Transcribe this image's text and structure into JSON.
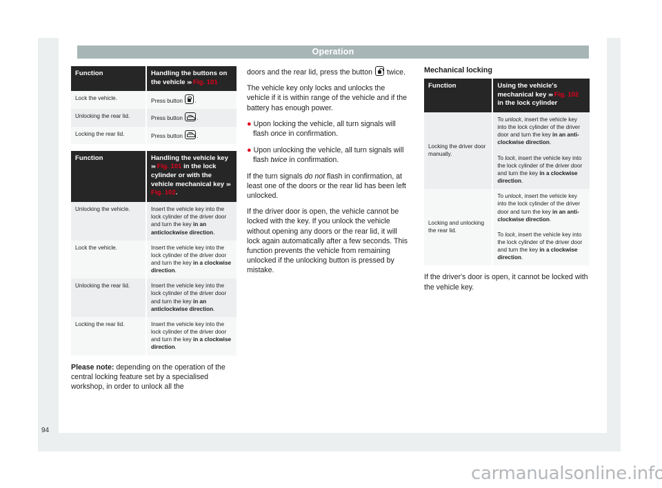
{
  "page": {
    "header_title": "Operation",
    "page_number": "94",
    "watermark": "carmanualsonline.info"
  },
  "column1": {
    "table_buttons": {
      "head_function": "Function",
      "head_handling": "Handling the buttons on the vehicle ››› Fig. 101",
      "head_handling_pre": "Handling the buttons on the vehicle",
      "head_handling_fig": "Fig. 101",
      "rows": [
        {
          "function": "Lock the vehicle.",
          "action_pre": "Press button ",
          "action_icon": "lock-icon",
          "action_post": "."
        },
        {
          "function": "Unlocking the rear lid.",
          "action_pre": "Press button ",
          "action_icon": "trunk-icon",
          "action_post": "."
        },
        {
          "function": "Locking the rear lid.",
          "action_pre": "Press button ",
          "action_icon": "trunk-icon",
          "action_post": "."
        }
      ]
    },
    "table_key": {
      "head_function": "Function",
      "head_handling_a": "Handling the vehicle key",
      "head_fig_101": "Fig. 101",
      "head_handling_b": "in the lock cylinder or with the vehicle mechanical key",
      "head_fig_102": "Fig. 102",
      "head_handling_end": ".",
      "rows": [
        {
          "function": "Unlocking the vehicle.",
          "text_pre": "Insert the vehicle key into the lock cylinder of the driver door and turn the key ",
          "text_bold": "in an anticlockwise direction",
          "text_post": "."
        },
        {
          "function": "Lock the vehicle.",
          "text_pre": "Insert the vehicle key into the lock cylinder of the driver door and turn the key ",
          "text_bold": "in a clockwise direction",
          "text_post": "."
        },
        {
          "function": "Unlocking the rear lid.",
          "text_pre": "Insert the vehicle key into the lock cylinder of the driver door and turn the key ",
          "text_bold": "in an anticlockwise direction",
          "text_post": "."
        },
        {
          "function": "Locking the rear lid.",
          "text_pre": "Insert the vehicle key into the lock cylinder of the driver door and turn the key ",
          "text_bold": "in a clockwise direction",
          "text_post": "."
        }
      ]
    },
    "note": {
      "label": "Please note:",
      "text": " depending on the operation of the central locking feature set by a specialised workshop, in order to unlock all the"
    }
  },
  "column2": {
    "para_1_pre": "doors and the rear lid, press the button ",
    "para_1_icon": "unlock-icon",
    "para_1_post": " twice.",
    "para_2": "The vehicle key only locks and unlocks the vehicle if it is within range of the vehicle and if the battery has enough power.",
    "bullet_1_pre": "Upon locking the vehicle, all turn signals will flash ",
    "bullet_1_em": "once",
    "bullet_1_post": " in confirmation.",
    "bullet_2_pre": "Upon unlocking the vehicle, all turn signals will flash ",
    "bullet_2_em": "twice",
    "bullet_2_post": " in confirmation.",
    "para_3_pre": "If the turn signals ",
    "para_3_em": "do not",
    "para_3_post": " flash in confirmation, at least one of the doors or the rear lid has been left unlocked.",
    "para_4": "If the driver door is open, the vehicle cannot be locked with the key. If you unlock the vehicle without opening any doors or the rear lid, it will lock again automatically after a few seconds. This function prevents the vehicle from remaining unlocked if the unlocking button is pressed by mistake."
  },
  "column3": {
    "heading": "Mechanical locking",
    "table": {
      "head_function": "Function",
      "head_using_pre": "Using the vehicle's mechanical key ",
      "head_fig_102": "Fig. 102",
      "head_using_post": " in the lock cylinder",
      "rows": [
        {
          "function": "Locking the driver door manually.",
          "cells": [
            {
              "pre": "To ",
              "em": "unlock",
              "mid": ", insert the vehicle key into the lock cylinder of the driver door and turn the key ",
              "bold": "in an anti-clockwise direction",
              "post": "."
            },
            {
              "pre": "To ",
              "em": "lock",
              "mid": ", insert the vehicle key into the lock cylinder of the driver door and turn the key ",
              "bold": "in a clockwise direction",
              "post": "."
            }
          ]
        },
        {
          "function": "Locking and unlocking the rear lid.",
          "cells": [
            {
              "pre": "To ",
              "em": "unlock",
              "mid": ", insert the vehicle key into the lock cylinder of the driver door and turn the key ",
              "bold": "in an anti-clockwise direction",
              "post": "."
            },
            {
              "pre": "To ",
              "em": "lock",
              "mid": ", insert the vehicle key into the lock cylinder of the driver door and turn the key ",
              "bold": "in a clockwise direction",
              "post": "."
            }
          ]
        }
      ]
    },
    "tail": "If the driver's door is open, it cannot be locked with the vehicle key."
  },
  "colors": {
    "fig_red": "#e1001a",
    "header_band": "#a8b5b6",
    "table_head": "#262626",
    "row_odd": "#eceeef",
    "row_even": "#f6f7f7"
  }
}
